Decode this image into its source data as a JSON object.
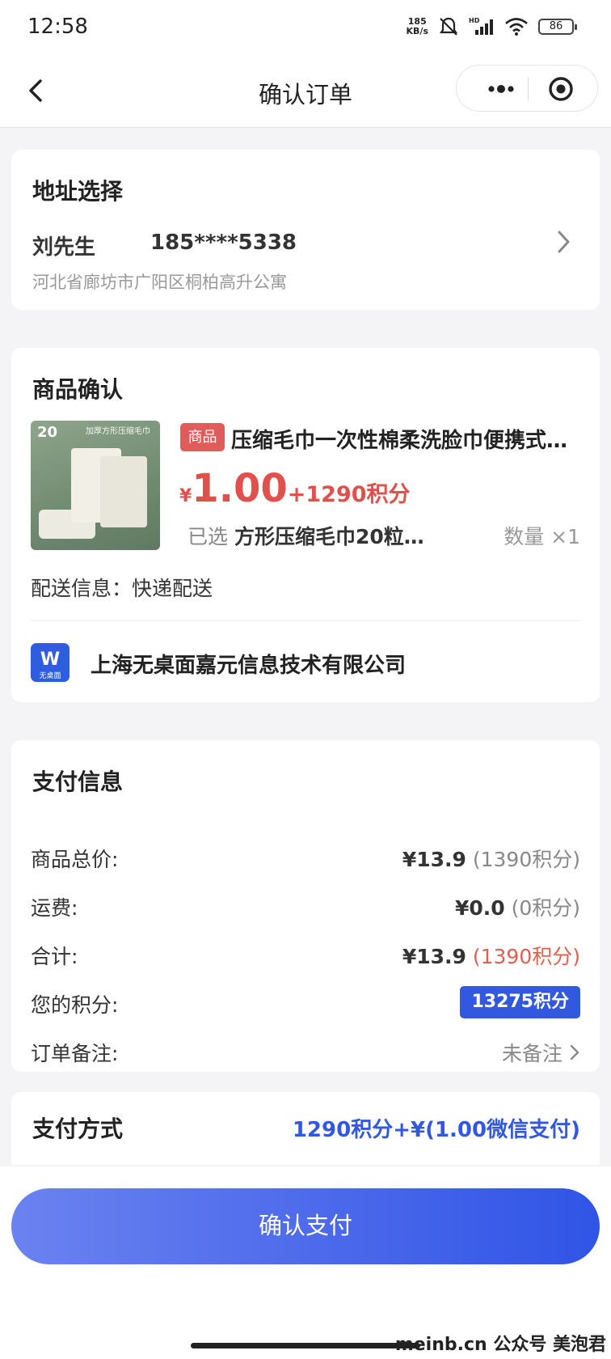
{
  "status_bar": {
    "time": "12:58",
    "net_speed_value": "185",
    "net_speed_unit": "KB/s",
    "network_type": "HD",
    "battery": "86"
  },
  "nav": {
    "title": "确认订单"
  },
  "address": {
    "section_title": "地址选择",
    "name": "刘先生",
    "phone": "185****5338",
    "detail": "河北省廊坊市广阳区桐柏高升公寓"
  },
  "product": {
    "section_title": "商品确认",
    "image_badge": "20",
    "image_label": "加厚方形压缩毛巾",
    "tag": "商品",
    "name": "压缩毛巾一次性棉柔洗脸巾便携式旅行装",
    "price_symbol": "¥",
    "price": "1.00",
    "points": "+1290积分",
    "spec_label": "已选",
    "spec": "方形压缩毛巾20粒…",
    "quantity": "数量 ×1",
    "delivery": "配送信息：快递配送",
    "shop_logo_text": "W",
    "shop_logo_sub": "无桌面",
    "shop_name": "上海无桌面嘉元信息技术有限公司"
  },
  "payment": {
    "section_title": "支付信息",
    "rows": [
      {
        "label": "商品总价:",
        "amount": "¥13.9",
        "points": " (1390积分)"
      },
      {
        "label": "运费:",
        "amount": "¥0.0",
        "points": " (0积分)"
      },
      {
        "label": "合计:",
        "amount": "¥13.9",
        "points": " (1390积分)"
      }
    ],
    "my_points_label": "您的积分:",
    "my_points": "13275积分",
    "remark_label": "订单备注:",
    "remark_value": "未备注"
  },
  "method": {
    "section_title": "支付方式",
    "value": "1290积分+¥(1.00微信支付)"
  },
  "confirm_button": "确认支付",
  "watermark": "meinb.cn  公众号 美泡君",
  "colors": {
    "accent_blue": "#3358e0",
    "price_red": "#e0504d",
    "tag_red": "#e05b5a"
  }
}
